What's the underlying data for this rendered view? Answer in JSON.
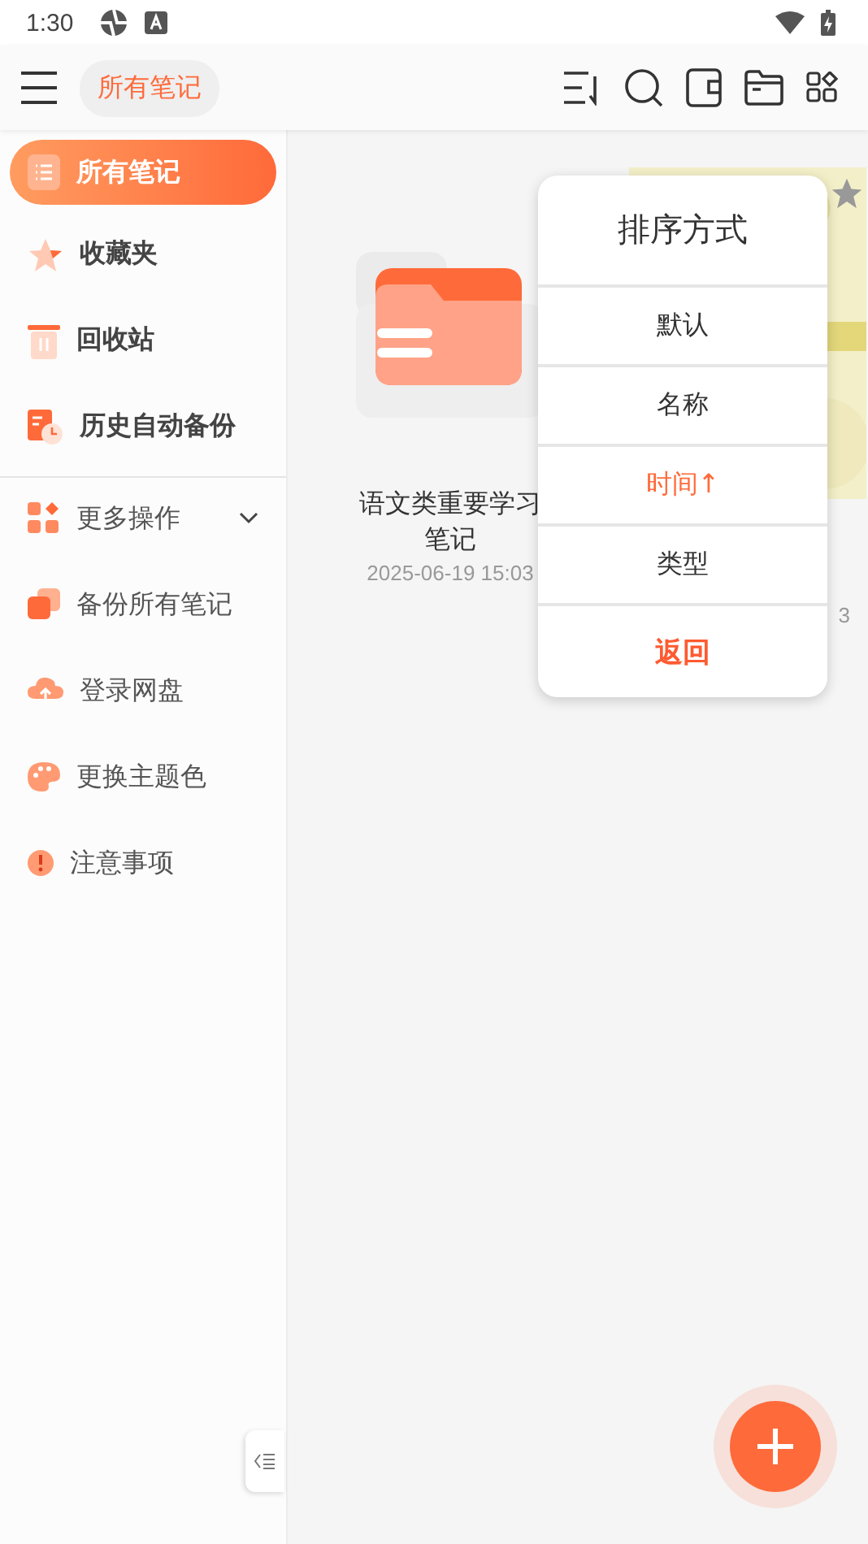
{
  "status_bar": {
    "time": "1:30"
  },
  "header": {
    "current_folder": "所有笔记"
  },
  "sidebar": {
    "items": [
      {
        "kind": "nav",
        "label": "所有笔记",
        "selected": true
      },
      {
        "kind": "nav",
        "label": "收藏夹",
        "selected": false
      },
      {
        "kind": "nav",
        "label": "回收站",
        "selected": false
      },
      {
        "kind": "nav",
        "label": "历史自动备份",
        "selected": false
      },
      {
        "kind": "group",
        "label": "更多操作",
        "expanded": false
      },
      {
        "kind": "action",
        "label": "备份所有笔记"
      },
      {
        "kind": "action",
        "label": "登录网盘"
      },
      {
        "kind": "action",
        "label": "更换主题色"
      },
      {
        "kind": "action",
        "label": "注意事项"
      }
    ]
  },
  "notes": [
    {
      "kind": "folder",
      "title": "语文类重要学习笔记",
      "date": "2025-06-19 15:03"
    },
    {
      "kind": "picture",
      "date": "3",
      "starred": true
    }
  ],
  "sort_menu": {
    "title": "排序方式",
    "options": [
      {
        "label": "默认",
        "selected": false
      },
      {
        "label": "名称",
        "selected": false
      },
      {
        "label": "时间↑",
        "selected": true
      },
      {
        "label": "类型",
        "selected": false
      }
    ],
    "back": "返回"
  }
}
